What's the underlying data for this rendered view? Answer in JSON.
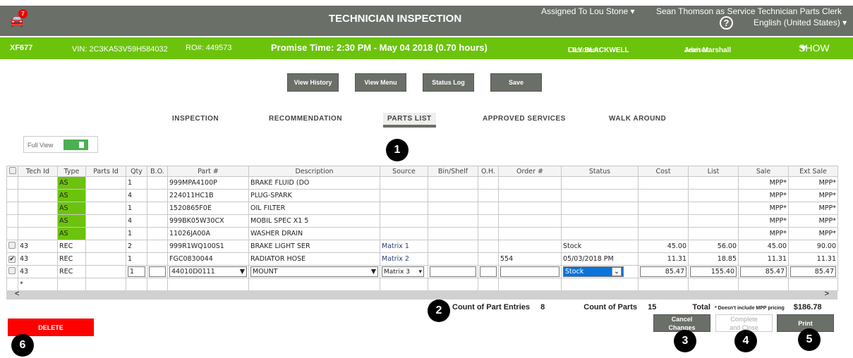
{
  "header": {
    "title": "TECHNICIAN INSPECTION",
    "notification_count": "7",
    "assigned": "Assigned To Lou Stone",
    "user": "Sean Thomson as Service Technician Parts Clerk",
    "language": "English (United States)",
    "help": "?"
  },
  "ro_bar": {
    "tag": "XF677",
    "vin": "VIN: 2C3KA53V59H584032",
    "ro": "RO#: 449573",
    "promise": "Promise Time: 2:30 PM - May 04 2018 (0.70 hours)",
    "customer_label": "Customer:",
    "customer": "LILY BLACKWELL",
    "advisor_label": "Advisor:",
    "advisor": "Jean Marshall",
    "show": "SHOW"
  },
  "actions": {
    "view_history": "View History",
    "view_menu": "View Menu",
    "status_log": "Status Log",
    "save": "Save"
  },
  "tabs": [
    {
      "label": "INSPECTION"
    },
    {
      "label": "RECOMMENDATION"
    },
    {
      "label": "PARTS LIST",
      "active": true
    },
    {
      "label": "APPROVED SERVICES"
    },
    {
      "label": "WALK AROUND"
    }
  ],
  "full_view": {
    "label": "Full View",
    "on": true
  },
  "table": {
    "columns": [
      "",
      "Tech Id",
      "Type",
      "Parts Id",
      "Qty",
      "B.O.",
      "Part #",
      "Description",
      "Source",
      "Bin/Shelf",
      "O.H.",
      "Order #",
      "Status",
      "Cost",
      "List",
      "Sale",
      "Ext Sale"
    ],
    "rows": [
      {
        "cb": "",
        "tech": "",
        "type": "AS",
        "parts": "",
        "qty": "1",
        "bo": "",
        "part": "999MPA4100P",
        "desc": "BRAKE FLUID (DO",
        "source": "",
        "bin": "",
        "oh": "",
        "order": "",
        "status": "",
        "cost": "",
        "list": "",
        "sale": "MPP*",
        "ext": "MPP*"
      },
      {
        "cb": "",
        "tech": "",
        "type": "AS",
        "parts": "",
        "qty": "4",
        "bo": "",
        "part": "224011HC1B",
        "desc": "PLUG-SPARK",
        "source": "",
        "bin": "",
        "oh": "",
        "order": "",
        "status": "",
        "cost": "",
        "list": "",
        "sale": "MPP*",
        "ext": "MPP*"
      },
      {
        "cb": "",
        "tech": "",
        "type": "AS",
        "parts": "",
        "qty": "1",
        "bo": "",
        "part": "1520865F0E",
        "desc": "OIL FILTER",
        "source": "",
        "bin": "",
        "oh": "",
        "order": "",
        "status": "",
        "cost": "",
        "list": "",
        "sale": "MPP*",
        "ext": "MPP*"
      },
      {
        "cb": "",
        "tech": "",
        "type": "AS",
        "parts": "",
        "qty": "4",
        "bo": "",
        "part": "999BK05W30CX",
        "desc": "MOBIL SPEC X1 5",
        "source": "",
        "bin": "",
        "oh": "",
        "order": "",
        "status": "",
        "cost": "",
        "list": "",
        "sale": "MPP*",
        "ext": "MPP*"
      },
      {
        "cb": "",
        "tech": "",
        "type": "AS",
        "parts": "",
        "qty": "1",
        "bo": "",
        "part": "11026JA00A",
        "desc": "WASHER DRAIN",
        "source": "",
        "bin": "",
        "oh": "",
        "order": "",
        "status": "",
        "cost": "",
        "list": "",
        "sale": "MPP*",
        "ext": "MPP*"
      },
      {
        "cb": "unchecked",
        "tech": "43",
        "type": "REC",
        "parts": "",
        "qty": "2",
        "bo": "",
        "part": "999R1WQ100S1",
        "desc": "BRAKE LIGHT SER",
        "source": "Matrix 1",
        "bin": "",
        "oh": "",
        "order": "",
        "status": "Stock",
        "cost": "45.00",
        "list": "56.00",
        "sale": "45.00",
        "ext": "90.00"
      },
      {
        "cb": "checked",
        "tech": "43",
        "type": "REC",
        "parts": "",
        "qty": "1",
        "bo": "",
        "part": "FGC0830044",
        "desc": "RADIATOR HOSE",
        "source": "Matrix 2",
        "bin": "",
        "oh": "",
        "order": "554",
        "status": "05/03/2018 PM",
        "cost": "11.31",
        "list": "18.85",
        "sale": "11.31",
        "ext": "11.31"
      }
    ],
    "edit_row": {
      "tech": "43",
      "type": "REC",
      "qty": "1",
      "bo": "",
      "part": "44010D0111",
      "desc": "MOUNT",
      "source": "Matrix 3",
      "bin": "",
      "oh": "",
      "order": "",
      "status": "Stock",
      "cost": "85.47",
      "list": "155.40",
      "sale": "85.47",
      "ext": "85.47"
    },
    "new_row_marker": "*"
  },
  "totals": {
    "entries_label": "Count of Part Entries",
    "entries": "8",
    "parts_label": "Count of Parts",
    "parts": "15",
    "total_label": "Total",
    "total_note": "* Doesn't include MPP pricing",
    "total": "$186.78"
  },
  "buttons": {
    "cancel": "Cancel Changes",
    "complete": "Complete and Close",
    "print": "Print",
    "delete": "DELETE"
  },
  "markers": [
    "1",
    "2",
    "3",
    "4",
    "5",
    "6"
  ],
  "colors": {
    "header": "#6a6f68",
    "green": "#6cc30c",
    "delete": "#ff0000"
  }
}
